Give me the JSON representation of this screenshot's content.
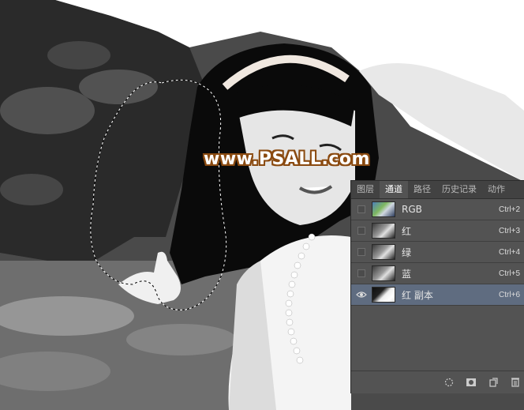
{
  "watermark": "www.PSALL.com",
  "channels_panel": {
    "tabs": [
      {
        "label": "图层"
      },
      {
        "label": "通道"
      },
      {
        "label": "路径"
      },
      {
        "label": "历史记录"
      },
      {
        "label": "动作"
      }
    ],
    "active_tab": "通道",
    "rows": [
      {
        "name": "RGB",
        "shortcut": "Ctrl+2",
        "visible": false,
        "selected": false
      },
      {
        "name": "红",
        "shortcut": "Ctrl+3",
        "visible": false,
        "selected": false
      },
      {
        "name": "绿",
        "shortcut": "Ctrl+4",
        "visible": false,
        "selected": false
      },
      {
        "name": "蓝",
        "shortcut": "Ctrl+5",
        "visible": false,
        "selected": false
      },
      {
        "name": "红 副本",
        "shortcut": "Ctrl+6",
        "visible": true,
        "selected": true
      }
    ],
    "bottom_icons": [
      "load-selection-icon",
      "save-selection-icon",
      "new-channel-icon",
      "trash-icon"
    ]
  }
}
